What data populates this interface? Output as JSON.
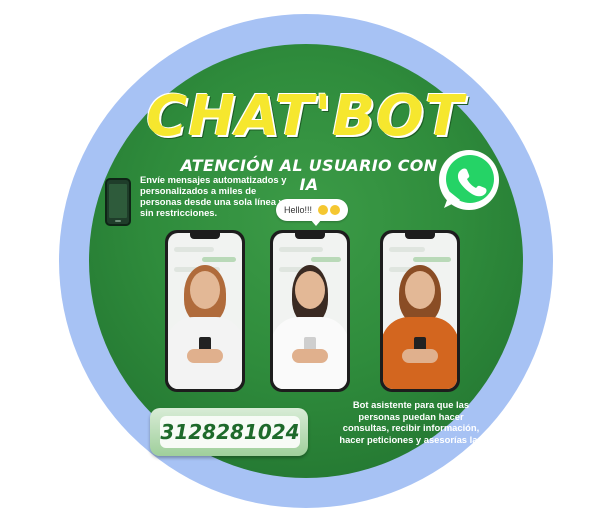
{
  "title": "CHAT'BOT",
  "subtitle": "ATENCIÓN AL USUARIO CON IA",
  "intro_text": "Envíe mensajes automatizados y personalizados a miles de personas desde una sola línea y sin restricciones.",
  "chat_bubble": {
    "text": "Hello!!!"
  },
  "phone_number": "3128281024",
  "outro_text": "Bot asistente para que las personas puedan hacer consultas, recibir información, hacer peticiones y asesorías las",
  "icons": {
    "messaging": "whatsapp-icon",
    "device": "smartphone-icon"
  },
  "colors": {
    "ring": "#a7c2f4",
    "background_green": "#2f8c3c",
    "title_yellow": "#f6e72e",
    "whatsapp_green": "#25d366",
    "number_text": "#1e6a2b"
  },
  "people": [
    {
      "label": "woman-white-shirt"
    },
    {
      "label": "woman-white-blouse"
    },
    {
      "label": "woman-orange-shirt"
    }
  ]
}
